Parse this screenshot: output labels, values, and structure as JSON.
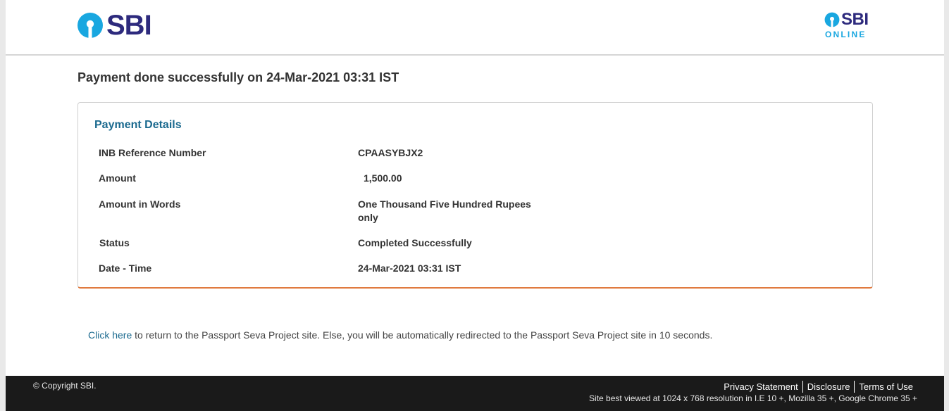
{
  "header": {
    "logo_text": "SBI",
    "logo_right_text": "SBI",
    "logo_right_sub": "ONLINE"
  },
  "main": {
    "success_title": "Payment done successfully on 24-Mar-2021 03:31 IST",
    "card_title": "Payment Details",
    "rows": [
      {
        "label": "INB Reference Number",
        "value": "CPAASYBJX2"
      },
      {
        "label": "Amount",
        "value": "1,500.00"
      },
      {
        "label": "Amount in Words",
        "value": "One Thousand Five Hundred Rupees only"
      },
      {
        "label": "Status",
        "value": "Completed Successfully"
      },
      {
        "label": "Date - Time",
        "value": "24-Mar-2021 03:31 IST"
      }
    ],
    "return_link": "Click here",
    "return_text": " to return to the Passport Seva Project site. Else, you will be automatically redirected to the Passport Seva Project site in 10 seconds."
  },
  "footer": {
    "copyright": "© Copyright SBI.",
    "links": [
      "Privacy Statement",
      "Disclosure",
      "Terms of Use"
    ],
    "best_viewed": "Site best viewed at 1024 x 768 resolution in I.E 10 +, Mozilla 35 +, Google Chrome 35 +"
  },
  "colors": {
    "brand": "#2d2a7d",
    "logo_blue": "#19a7e0",
    "accent": "#1b6a8f",
    "card_underline": "#e07a3f",
    "footer_bg": "#1a1a1a"
  }
}
